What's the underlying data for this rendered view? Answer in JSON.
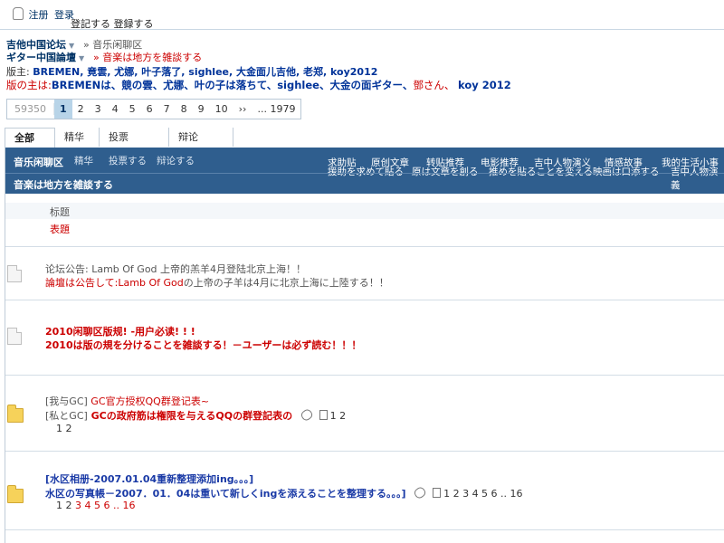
{
  "topbar": {
    "register": "注册",
    "login": "登录",
    "jp": "登記する 登録する"
  },
  "breadcrumb": {
    "forum": "吉他中国论坛",
    "current": "» 音乐闲聊区",
    "forum_jp": "ギター中国論壇",
    "current_jp": "» 音楽は地方を雑談する"
  },
  "moderators": {
    "label": "版主:",
    "names": "BREMEN, 竟雲, 尤娜, 叶子落了, sighlee, 大金面儿吉他, 老郑, koy2012",
    "label_jp": "版の主は:",
    "names_jp": "BREMENは、競の雲、尤娜、叶の子は落ちて、sighlee、大金の面ギター、",
    "tail_jp": "鄧さん、",
    "last_jp": "koy 2012"
  },
  "pager": {
    "total": "59350",
    "pages": [
      "1",
      "2",
      "3",
      "4",
      "5",
      "6",
      "7",
      "8",
      "9",
      "10",
      "››",
      "... 1979"
    ],
    "current": "1"
  },
  "tabs": [
    "全部",
    "精华",
    "投票",
    "辩论"
  ],
  "band": {
    "name": "音乐闲聊区",
    "sub": [
      {
        "cn": "精华",
        "jp": "精華"
      },
      {
        "cn": "投票する",
        "jp": ""
      },
      {
        "cn": "辩论する",
        "jp": ""
      }
    ],
    "cats": [
      {
        "cn": "求助贴",
        "jp": "援助を求めて貼る"
      },
      {
        "cn": "原创文章",
        "jp": "原は文章を創る"
      },
      {
        "cn": "转贴推荐",
        "jp": "ちょう"
      },
      {
        "cn": "电影推荐",
        "jp": "推めを貼ることを変える"
      },
      {
        "cn": "吉中人物演义",
        "jp": "映画は口添する"
      },
      {
        "cn": "情感故事",
        "jp": "吉中人物演義"
      },
      {
        "cn": "我的生活小事",
        "jp": ""
      }
    ],
    "name_jp": "音楽は地方を雑談する"
  },
  "thead": {
    "title": "标题",
    "title_jp": "表題"
  },
  "threads": [
    {
      "cn": "论坛公告: Lamb Of God 上帝的羔羊4月登陆北京上海！！",
      "jp_a": "論壇は公告して:",
      "jp_b": "Lamb Of God",
      "jp_c": "の上帝の子羊は4月に北京上海に上陸する！！"
    },
    {
      "cn": "2010闲聊区版规! -用户必读! ! !",
      "jp": "2010は版の規を分けることを雑談する！－ユーザーは必ず読む！！！"
    },
    {
      "cn_a": "[我与GC]",
      "cn_b": " GC官方授权QQ群登记表~",
      "jp_a": "[私とGC]",
      "jp_b": " GCの政府筋は権限を与えるQQの群登記表の",
      "pages": "1  2",
      "pages2": "1 2"
    },
    {
      "cn": "[水区相册-2007.01.04重新整理添加ing。。。]",
      "jp": "水区の写真帳－2007．01．04は重いて新しくingを添えることを整理する。。。]",
      "pages": "1  2  3  4  5  6 ..  16",
      "pages2_a": "1 2 ",
      "pages2_b": "3 4 5 6 .. 16"
    }
  ]
}
